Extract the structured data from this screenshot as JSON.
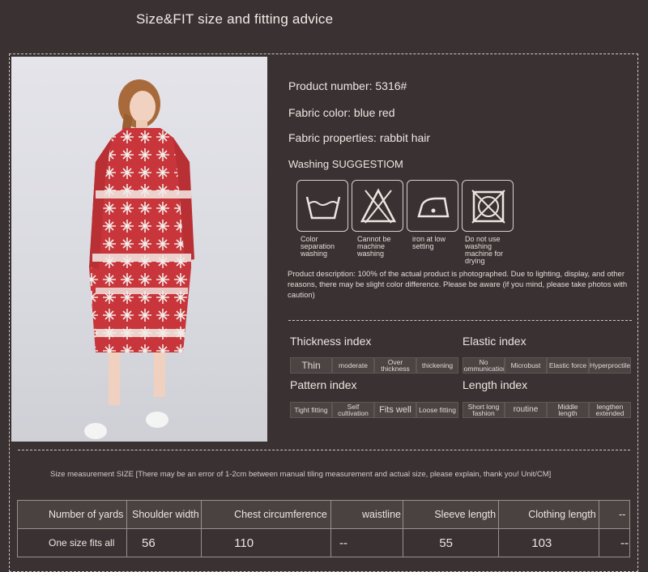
{
  "header": {
    "title": "Size&FIT size and fitting advice"
  },
  "product": {
    "number": "Product number: 5316#",
    "color": "Fabric color: blue red",
    "properties": "Fabric properties: rabbit hair",
    "washing_title": "Washing SUGGESTIOM",
    "wash_icons": [
      {
        "icon": "wash-basin-icon",
        "label": "Color separation washing"
      },
      {
        "icon": "no-machine-wash-icon",
        "label": "Cannot be machine washing"
      },
      {
        "icon": "iron-icon",
        "label": "iron at low setting"
      },
      {
        "icon": "no-tumble-dry-icon",
        "label": "Do not use washing machine for drying"
      }
    ],
    "description": "Product description: 100% of the actual product is photographed. Due to lighting, display, and other reasons, there may be slight color difference. Please be aware (if you mind, please take photos with caution)"
  },
  "indexes": {
    "thickness": {
      "title": "Thickness index",
      "options": [
        "Thin",
        "moderate",
        "Over thickness",
        "thickening"
      ]
    },
    "elastic": {
      "title": "Elastic index",
      "options": [
        "No communication",
        "Microbust",
        "Elastic force",
        "Hyperproctile"
      ]
    },
    "pattern": {
      "title": "Pattern index",
      "options": [
        "Tight fitting",
        "Self cultivation",
        "Fits well",
        "Loose fitting"
      ]
    },
    "length": {
      "title": "Length index",
      "options": [
        "Short long fashion",
        "routine",
        "Middle length",
        "lengthen extended"
      ]
    }
  },
  "size": {
    "note": "Size measurement SIZE [There may be an error of 1-2cm between manual tiling measurement and actual size, please explain, thank you! Unit/CM]",
    "headers": [
      "Number of yards",
      "Shoulder width",
      "Chest circumference",
      "waistline",
      "Sleeve length",
      "Clothing length",
      "--"
    ],
    "rows": [
      [
        "One size fits all",
        "56",
        "110",
        "--",
        "55",
        "103",
        "--"
      ]
    ]
  },
  "colors": {
    "background": "#3a3232",
    "dress_red": "#c8353a",
    "pattern_white": "#f2ece8"
  }
}
